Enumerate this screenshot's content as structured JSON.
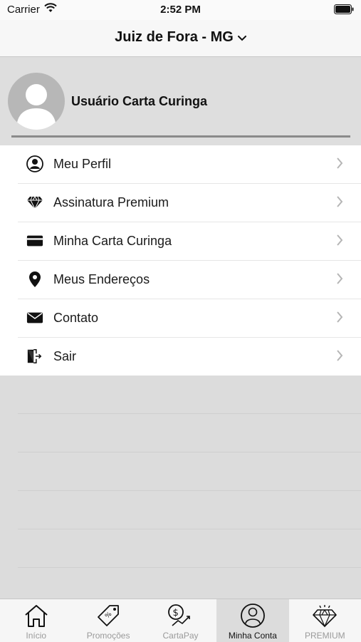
{
  "status_bar": {
    "carrier": "Carrier",
    "time": "2:52 PM"
  },
  "nav": {
    "title": "Juiz de Fora - MG"
  },
  "profile": {
    "name": "Usuário Carta Curinga"
  },
  "menu": [
    {
      "label": "Meu Perfil",
      "icon": "user-circle-icon"
    },
    {
      "label": "Assinatura Premium",
      "icon": "diamond-icon"
    },
    {
      "label": "Minha Carta Curinga",
      "icon": "card-icon"
    },
    {
      "label": "Meus Endereços",
      "icon": "location-pin-icon"
    },
    {
      "label": "Contato",
      "icon": "envelope-icon"
    },
    {
      "label": "Sair",
      "icon": "exit-door-icon"
    }
  ],
  "tabs": [
    {
      "label": "Início",
      "icon": "home-icon"
    },
    {
      "label": "Promoções",
      "icon": "price-tag-icon"
    },
    {
      "label": "CartaPay",
      "icon": "dollar-chart-icon"
    },
    {
      "label": "Minha Conta",
      "icon": "user-icon",
      "active": true
    },
    {
      "label": "PREMIUM",
      "icon": "diamond-icon"
    }
  ]
}
